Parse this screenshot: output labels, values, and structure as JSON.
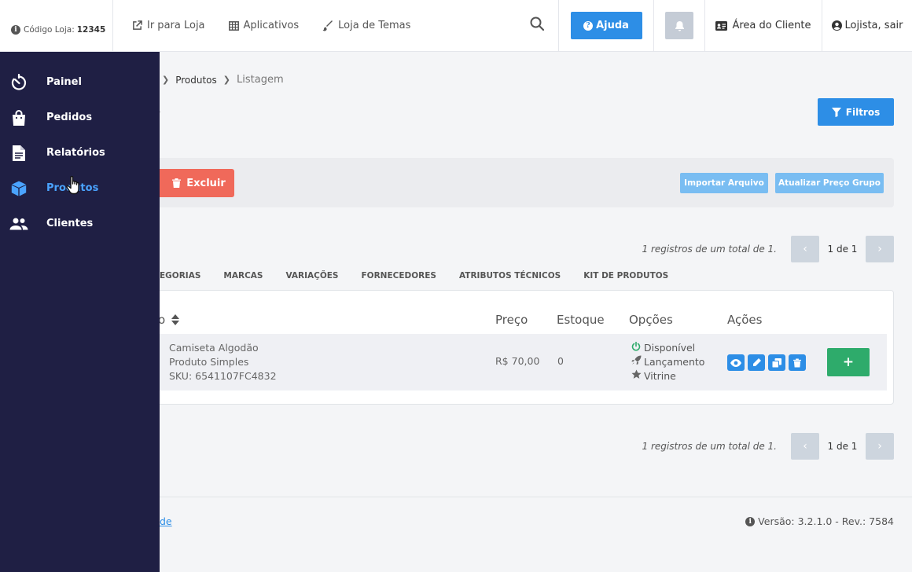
{
  "header": {
    "store_code_label": "Código Loja:",
    "store_code_value": "12345",
    "links": [
      {
        "label": "Ir para Loja",
        "icon": "external-link-icon"
      },
      {
        "label": "Aplicativos",
        "icon": "grid-icon"
      },
      {
        "label": "Loja de Temas",
        "icon": "brush-icon"
      }
    ],
    "help_label": "Ajuda",
    "client_area_label": "Área do Cliente",
    "user_label": "Lojista, sair"
  },
  "sidebar": {
    "items": [
      {
        "label": "Painel",
        "icon": "dashboard-icon"
      },
      {
        "label": "Pedidos",
        "icon": "bag-icon"
      },
      {
        "label": "Relatórios",
        "icon": "document-icon"
      },
      {
        "label": "Produtos",
        "icon": "box-icon",
        "active": true
      },
      {
        "label": "Clientes",
        "icon": "users-icon"
      }
    ]
  },
  "breadcrumb": {
    "items": [
      "Produtos",
      "Listagem"
    ]
  },
  "page": {
    "title_fragment": "s",
    "filters_label": "Filtros"
  },
  "actions": {
    "delete_label": "Excluir",
    "import_label": "Importar Arquivo",
    "update_price_label": "Atualizar Preço Grupo"
  },
  "pagination": {
    "info": "1 registros de um total de 1.",
    "pages": "1 de 1"
  },
  "tabs": [
    "EGORIAS",
    "MARCAS",
    "VARIAÇÕES",
    "FORNECEDORES",
    "ATRIBUTOS TÉCNICOS",
    "KIT DE PRODUTOS"
  ],
  "table": {
    "headers": {
      "name_fragment": "o",
      "price": "Preço",
      "stock": "Estoque",
      "options": "Opções",
      "actions": "Ações"
    },
    "rows": [
      {
        "name": "Camiseta Algodão",
        "type": "Produto Simples",
        "sku": "SKU: 6541107FC4832",
        "price": "R$ 70,00",
        "stock": "0",
        "options": [
          "Disponível",
          "Lançamento",
          "Vitrine"
        ]
      }
    ],
    "add_label": "+"
  },
  "footer": {
    "link_fragment": "de",
    "version": "Versão: 3.2.1.0 - Rev.: 7584"
  },
  "colors": {
    "primary": "#2d8ee6",
    "danger": "#f0695a",
    "success": "#2eab6b",
    "sidebar_bg": "#1f1f44",
    "sidebar_active": "#4aa3ff"
  }
}
